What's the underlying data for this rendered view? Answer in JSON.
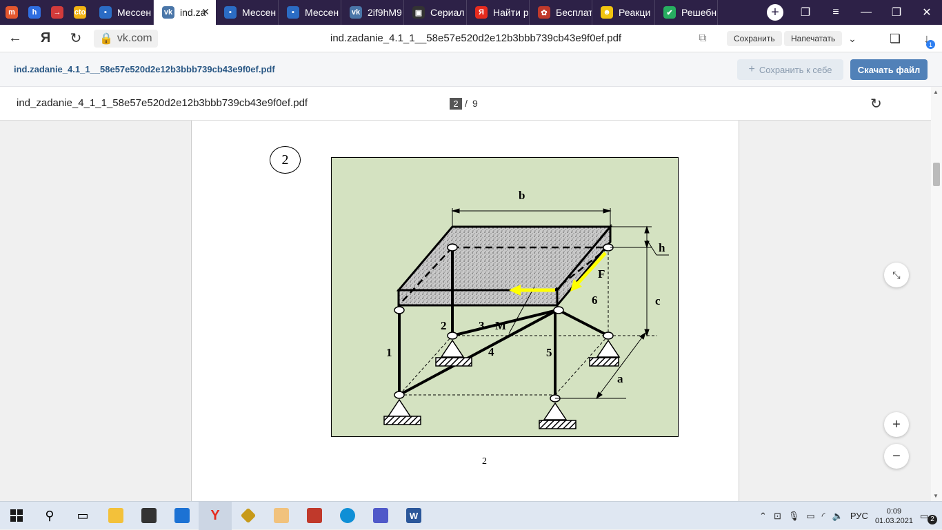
{
  "tabs": [
    {
      "label": "",
      "icon": "m",
      "color": "#e4572e",
      "pinned": true
    },
    {
      "label": "",
      "icon": "h",
      "color": "#2f6ee0",
      "pinned": true
    },
    {
      "label": "",
      "icon": "→",
      "color": "#d23b3b",
      "pinned": true
    },
    {
      "label": "",
      "icon": "cto",
      "color": "#f2b313",
      "pinned": true
    },
    {
      "label": "Мессен",
      "icon": "▪",
      "color": "#2b6cc4"
    },
    {
      "label": "ind.za",
      "icon": "vk",
      "color": "#4a76a8",
      "active": true
    },
    {
      "label": "Мессен",
      "icon": "▪",
      "color": "#2b6cc4"
    },
    {
      "label": "Мессен",
      "icon": "▪",
      "color": "#2b6cc4"
    },
    {
      "label": "2if9hM9",
      "icon": "vk",
      "color": "#4a76a8"
    },
    {
      "label": "Сериал",
      "icon": "▣",
      "color": "#333"
    },
    {
      "label": "Найти р",
      "icon": "Я",
      "color": "#e62b1e"
    },
    {
      "label": "Бесплат",
      "icon": "✿",
      "color": "#c0392b"
    },
    {
      "label": "Реакци",
      "icon": "☻",
      "color": "#f1c40f"
    },
    {
      "label": "Решебн",
      "icon": "✔",
      "color": "#27ae60"
    }
  ],
  "browser": {
    "domain": "vk.com",
    "page_title": "ind.zadanie_4.1_1__58e57e520d2e12b3bbb739cb43e9f0ef.pdf",
    "save_label": "Сохранить",
    "print_label": "Напечатать",
    "downloads_badge": "1"
  },
  "vk": {
    "file_name": "ind.zadanie_4.1_1__58e57e520d2e12b3bbb739cb43e9f0ef.pdf",
    "save_to_me": "Сохранить к себе",
    "download": "Скачать файл"
  },
  "pdf": {
    "file_name": "ind_zadanie_4_1_1_58e57e520d2e12b3bbb739cb43e9f0ef.pdf",
    "current_page": "2",
    "separator": "/",
    "total_pages": "9",
    "question_number": "2",
    "page_footer": "2"
  },
  "figure": {
    "labels": {
      "b": "b",
      "h": "h",
      "c": "c",
      "a": "a",
      "F": "F",
      "M": "M",
      "n1": "1",
      "n2": "2",
      "n3": "3",
      "n4": "4",
      "n5": "5",
      "n6": "6"
    },
    "background": "#d4e2c1",
    "arrow_color": "#ffff00"
  },
  "taskbar": {
    "lang": "РУС",
    "time": "0:09",
    "date": "01.03.2021",
    "notif_count": "2"
  }
}
